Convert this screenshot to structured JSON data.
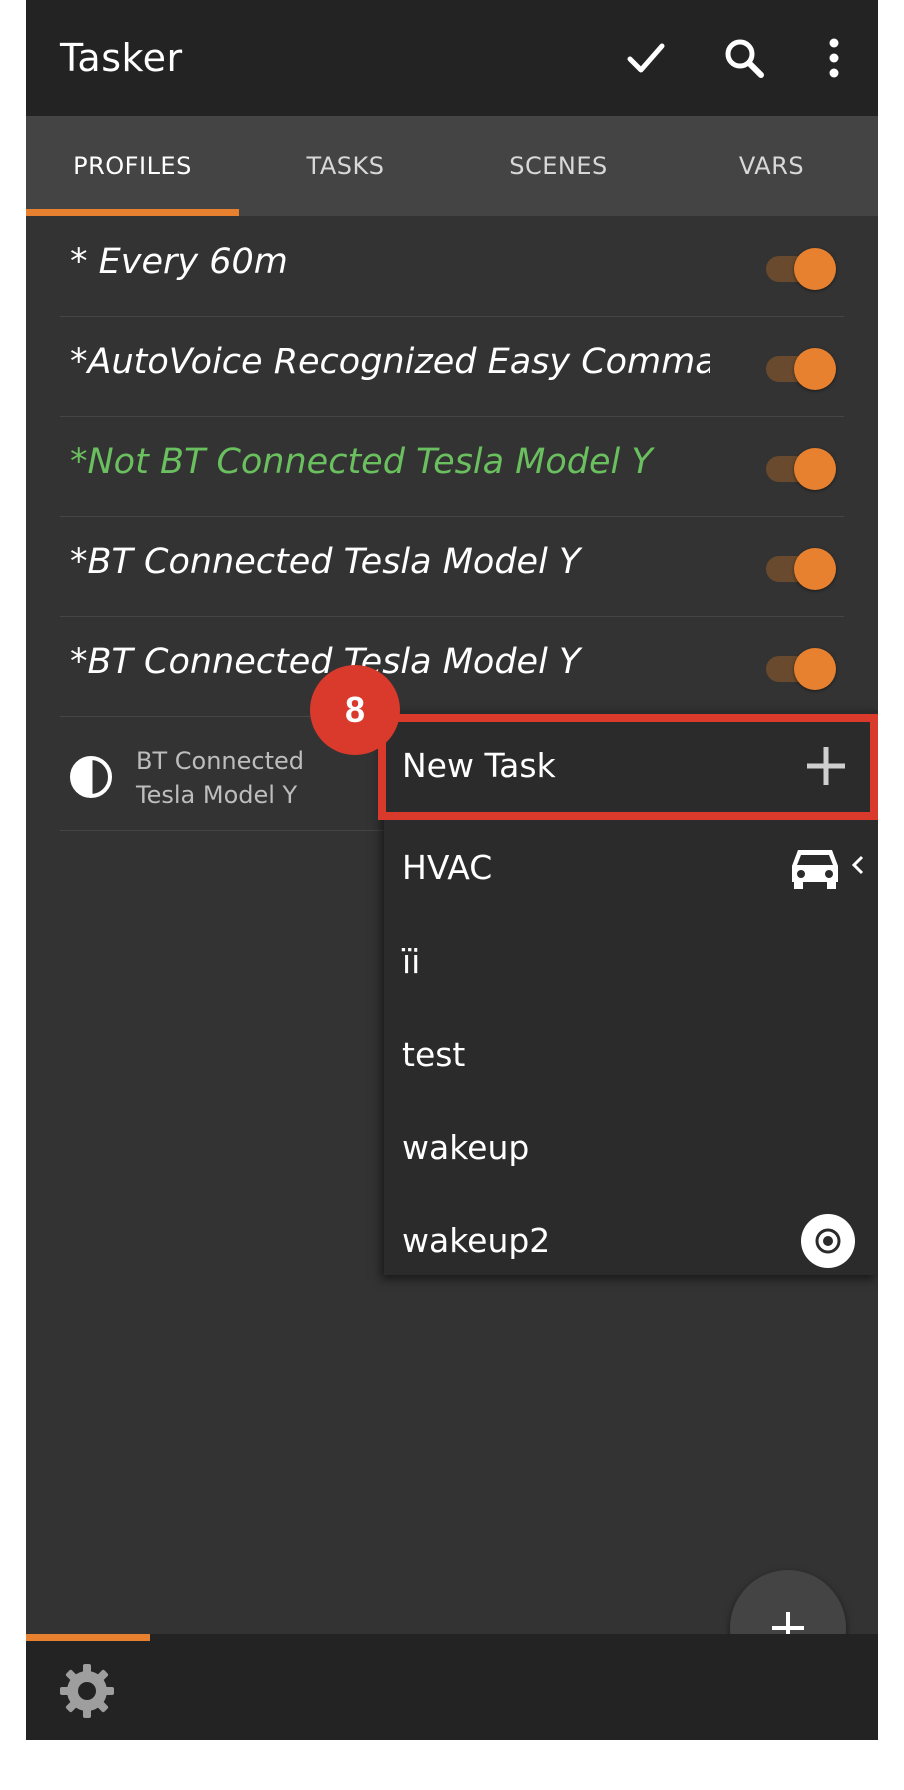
{
  "app": {
    "title": "Tasker"
  },
  "tabs": [
    {
      "label": "PROFILES",
      "active": true
    },
    {
      "label": "TASKS",
      "active": false
    },
    {
      "label": "SCENES",
      "active": false
    },
    {
      "label": "VARS",
      "active": false
    }
  ],
  "profiles": [
    {
      "name": "* Every 60m",
      "enabled": true,
      "color": "#ffffff"
    },
    {
      "name": "*AutoVoice Recognized Easy Commands",
      "enabled": true,
      "color": "#ffffff"
    },
    {
      "name": "*Not BT Connected Tesla Model Y",
      "enabled": true,
      "color": "#6abf5e"
    },
    {
      "name": "*BT Connected Tesla Model Y",
      "enabled": true,
      "color": "#ffffff"
    },
    {
      "name": "*BT Connected Tesla Model Y",
      "enabled": true,
      "color": "#ffffff"
    }
  ],
  "expanded_task": {
    "label_line1": "BT Connected",
    "label_line2": "Tesla Model Y",
    "icon": "half-circle-icon"
  },
  "task_menu": {
    "items": [
      {
        "label": "New Task",
        "icon": "plus-icon"
      },
      {
        "label": "HVAC",
        "icon": "car-icon"
      },
      {
        "label": "ïi",
        "icon": ""
      },
      {
        "label": "test",
        "icon": ""
      },
      {
        "label": "wakeup",
        "icon": ""
      },
      {
        "label": "wakeup2",
        "icon": "record-icon"
      }
    ]
  },
  "annotation": {
    "step": "8"
  },
  "colors": {
    "accent": "#e8812f",
    "highlight": "#d93a2b",
    "background": "#333333",
    "active_profile_text": "#6abf5e"
  }
}
